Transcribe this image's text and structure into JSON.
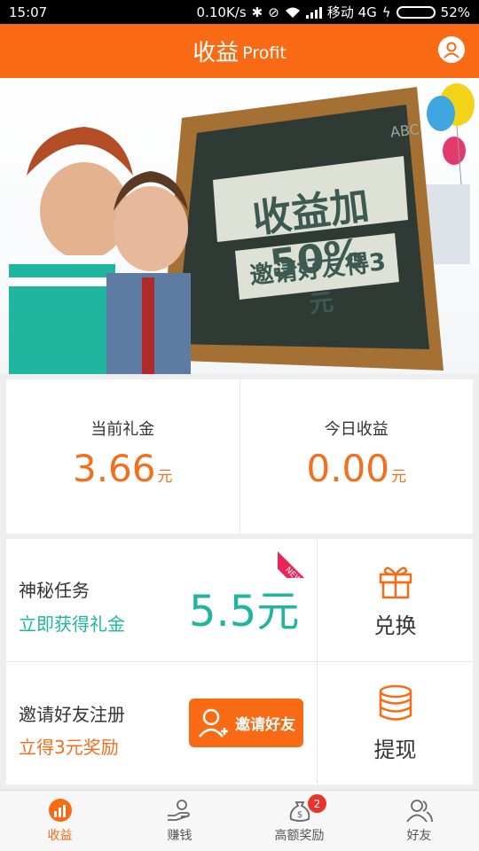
{
  "status_bar": {
    "time": "15:07",
    "network_speed": "0.10K/s",
    "carrier": "移动 4G",
    "battery": "52%",
    "battery_level": 0.52
  },
  "header": {
    "title_cn": "收益",
    "title_en": "Profit",
    "avatar_icon": "user-avatar-icon"
  },
  "banner": {
    "headline": "收益加50%",
    "subline": "邀请好友得3元",
    "board_text": "ABC"
  },
  "stats": {
    "current_gift": {
      "label": "当前礼金",
      "value": "3.66",
      "unit": "元"
    },
    "today_income": {
      "label": "今日收益",
      "value": "0.00",
      "unit": "元"
    }
  },
  "tasks": {
    "mystery": {
      "title": "神秘任务",
      "subtitle": "立即获得礼金",
      "amount": "5.5元",
      "ribbon": "NEW"
    },
    "invite": {
      "title": "邀请好友注册",
      "subtitle": "立得3元奖励",
      "button_label": "邀请好友"
    },
    "exchange": {
      "label": "兑换",
      "icon": "gift-icon"
    },
    "withdraw": {
      "label": "提现",
      "icon": "coins-stack-icon"
    }
  },
  "bottom_nav": {
    "items": [
      {
        "label": "收益",
        "icon": "profit-chart-icon",
        "active": true
      },
      {
        "label": "赚钱",
        "icon": "hand-coin-icon"
      },
      {
        "label": "高额奖励",
        "icon": "money-bag-icon",
        "badge": "2"
      },
      {
        "label": "好友",
        "icon": "friends-icon"
      }
    ]
  },
  "colors": {
    "brand_orange": "#f86a13",
    "value_orange": "#f26f1e",
    "teal": "#1fb59f",
    "badge_red": "#e8352c"
  }
}
